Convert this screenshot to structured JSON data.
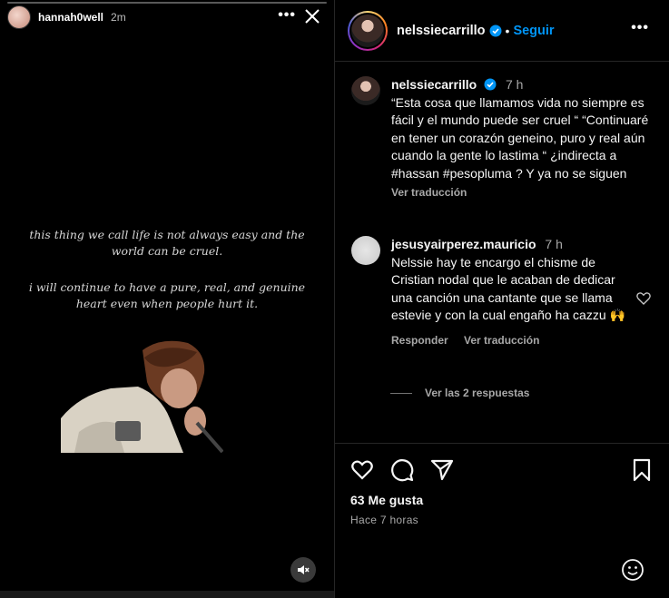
{
  "story": {
    "username": "hannah0well",
    "time": "2m",
    "more_icon": "more-horizontal-icon",
    "close_icon": "close-icon",
    "quote_line1": "this thing we call life is not always easy and the world can be cruel.",
    "quote_line2": "i will continue to have a pure, real, and genuine heart even when people hurt it.",
    "mute_icon": "speaker-muted-icon"
  },
  "post": {
    "header": {
      "username": "nelssiecarrillo",
      "separator": "•",
      "follow_label": "Seguir"
    },
    "caption": {
      "username": "nelssiecarrillo",
      "time": "7 h",
      "text": "“Esta cosa que llamamos vida no siempre es fácil y el mundo puede ser cruel “ “Continuaré en tener un corazón geneino, puro y real aún cuando la gente lo lastima “ ¿indirecta a #hassan #pesopluma ? Y ya no se siguen",
      "translate_label": "Ver traducción"
    },
    "comment": {
      "username": "jesusyairperez.mauricio",
      "time": "7 h",
      "text": "Nelssie hay te encargo el chisme de Cristian nodal que le acaban de dedicar una canción una cantante que se llama estevie y con la cual engaño ha cazzu 🙌",
      "reply_label": "Responder",
      "translate_label": "Ver traducción",
      "view_replies_label": "Ver las 2 respuestas"
    },
    "likes": "63 Me gusta",
    "posted_ago": "Hace 7 horas"
  },
  "colors": {
    "accent": "#0095f6",
    "verified": "#0095f6",
    "muted_text": "#a8a8a8"
  }
}
